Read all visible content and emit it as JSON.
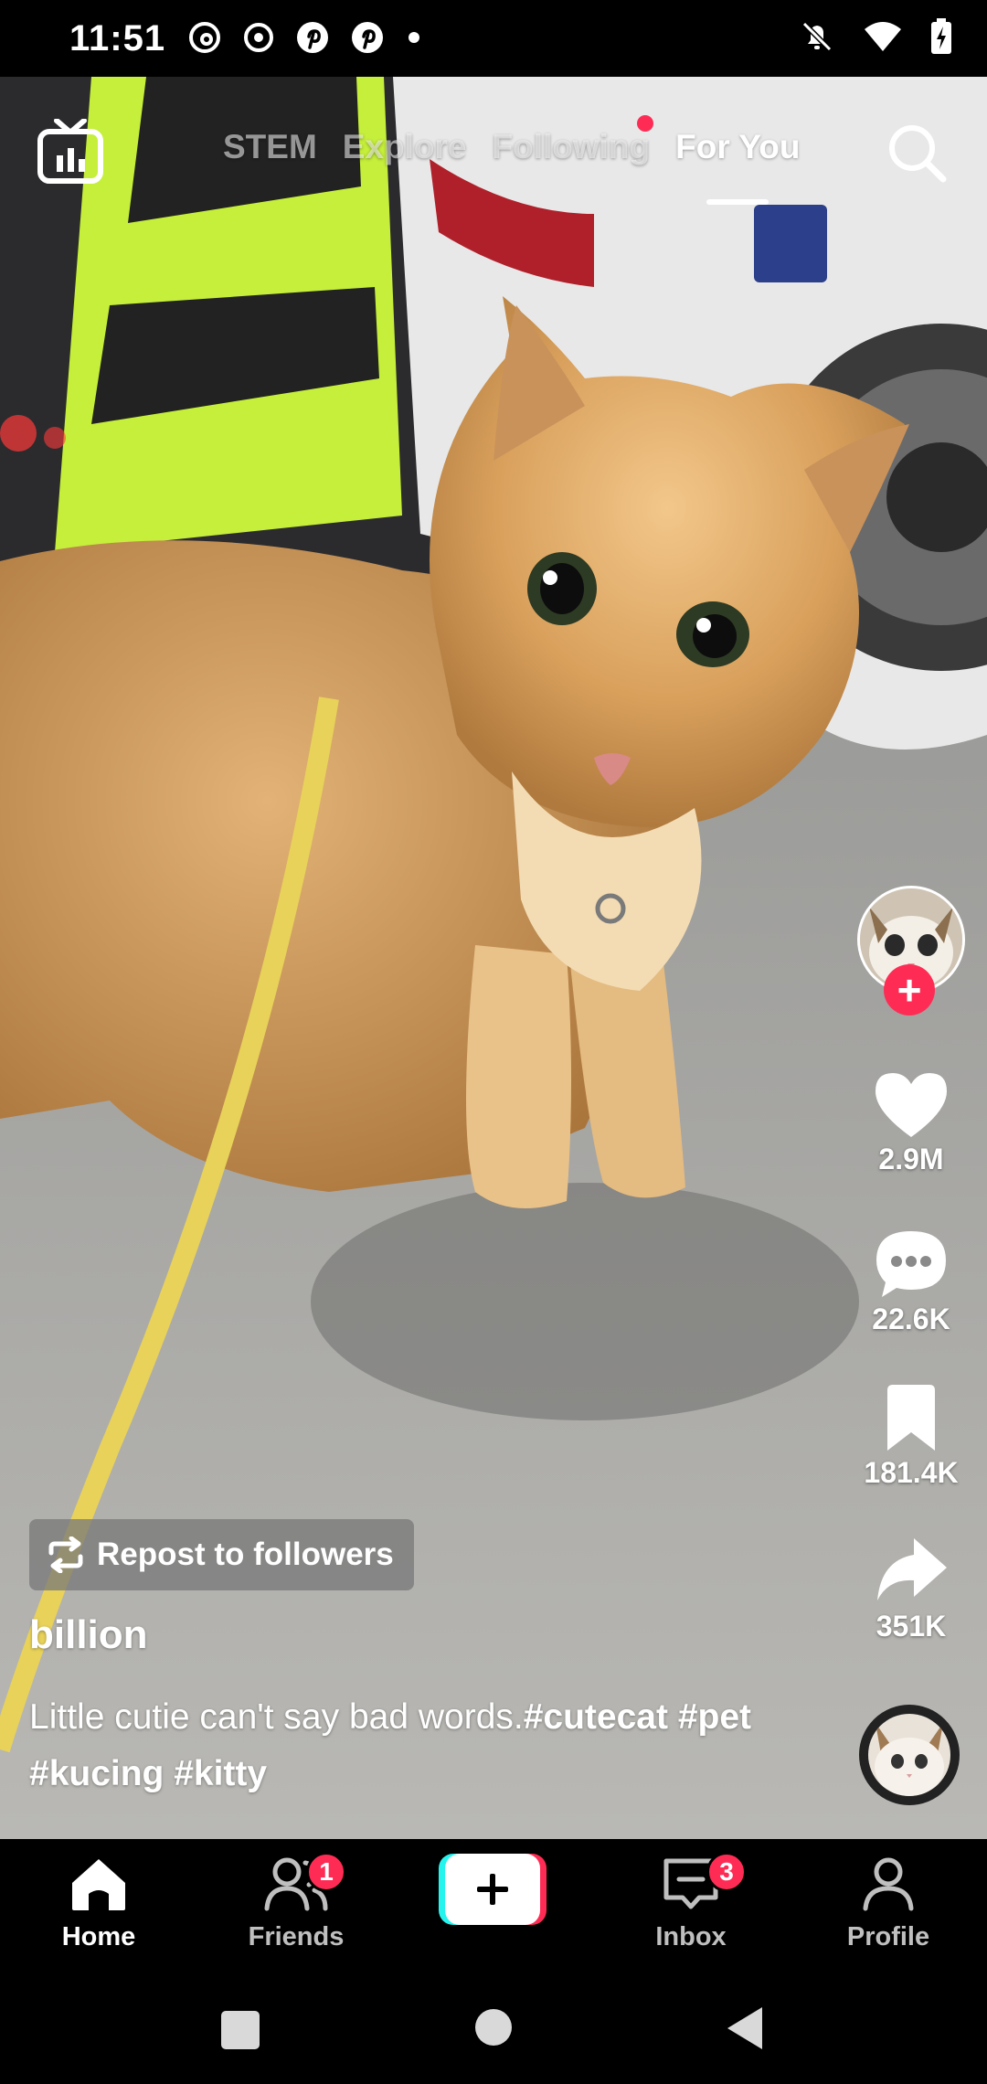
{
  "status_bar": {
    "time": "11:51",
    "left_icons": [
      "threads-icon",
      "record-icon",
      "pinterest-icon",
      "pinterest-icon",
      "dot-icon"
    ],
    "right_icons": [
      "mute-icon",
      "wifi-icon",
      "battery-charging-icon"
    ]
  },
  "top_nav": {
    "live_icon": "tv-icon",
    "tabs": [
      {
        "label": "STEM",
        "active": false
      },
      {
        "label": "Explore",
        "active": false
      },
      {
        "label": "Following",
        "active": false,
        "notification_dot": true
      },
      {
        "label": "For You",
        "active": true
      }
    ],
    "search_icon": "search-icon"
  },
  "actions": {
    "likes": "2.9M",
    "comments": "22.6K",
    "saves": "181.4K",
    "shares": "351K"
  },
  "post": {
    "repost_label": "Repost to followers",
    "username": "billion",
    "caption_text": "Little cutie can't say bad words.",
    "caption_tags": "#cutecat #pet #kucing #kitty"
  },
  "bottom_nav": {
    "items": [
      {
        "label": "Home",
        "icon": "home-icon",
        "active": true
      },
      {
        "label": "Friends",
        "icon": "friends-icon",
        "badge": "1"
      },
      {
        "label": "",
        "icon": "plus-icon"
      },
      {
        "label": "Inbox",
        "icon": "inbox-icon",
        "badge": "3"
      },
      {
        "label": "Profile",
        "icon": "profile-icon"
      }
    ]
  },
  "colors": {
    "accent": "#fe2c55",
    "create_cyan": "#25f4ee",
    "create_red": "#fe2c55"
  }
}
